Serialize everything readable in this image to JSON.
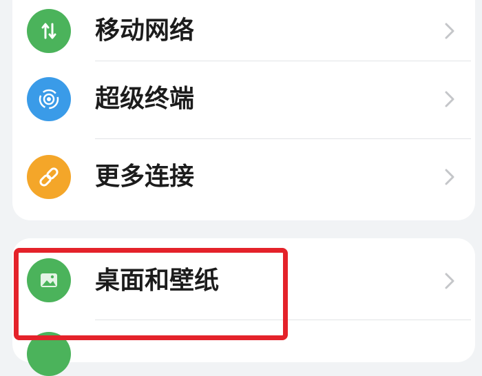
{
  "items": [
    {
      "label": "移动网络",
      "icon": "mobile-network-icon",
      "color": "#4bb35b"
    },
    {
      "label": "超级终端",
      "icon": "super-device-icon",
      "color": "#3a9be8"
    },
    {
      "label": "更多连接",
      "icon": "more-connections-icon",
      "color": "#f4a629"
    },
    {
      "label": "桌面和壁纸",
      "icon": "wallpaper-icon",
      "color": "#4bb35b"
    }
  ],
  "highlight_color": "#e4222a"
}
